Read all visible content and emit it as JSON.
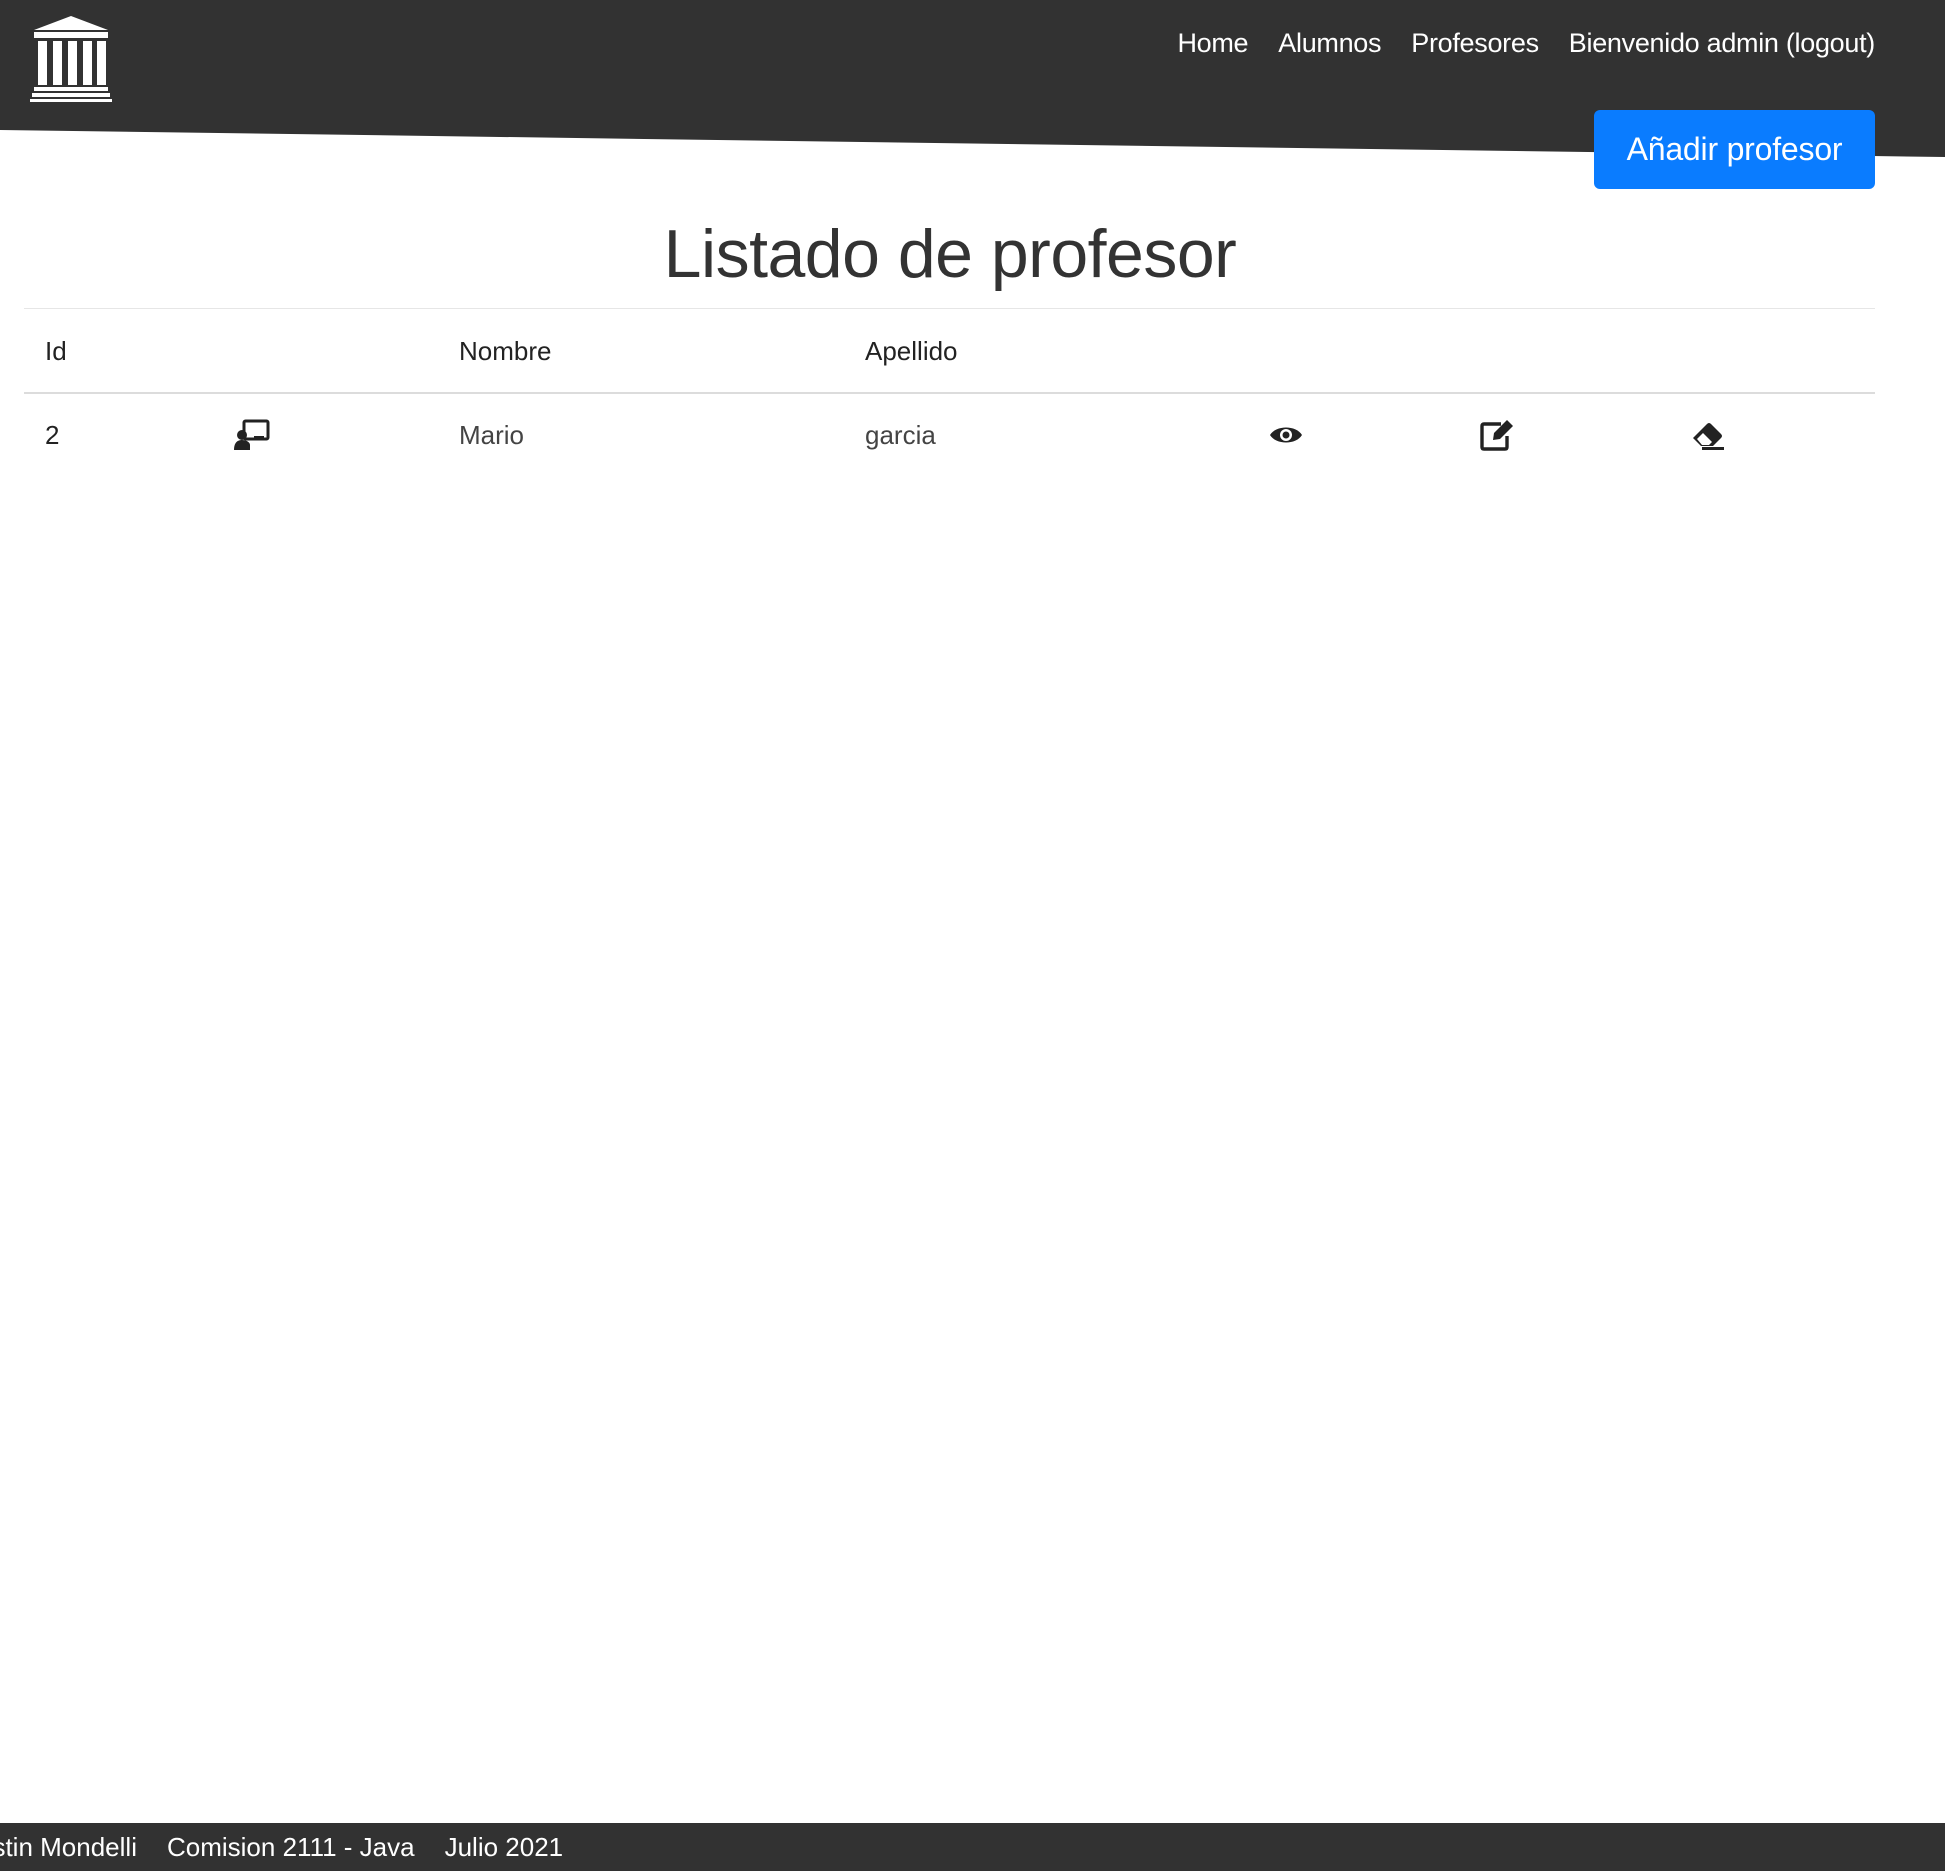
{
  "header": {
    "logo_icon": "building-columns-icon",
    "background_color": "#323232",
    "nav": [
      {
        "label": "Home"
      },
      {
        "label": "Alumnos"
      },
      {
        "label": "Profesores"
      },
      {
        "label": "Bienvenido admin (logout)"
      }
    ],
    "add_button_label": "Añadir profesor",
    "add_button_color": "#0a7cff"
  },
  "main": {
    "title": "Listado de profesor",
    "table": {
      "columns": [
        "Id",
        "",
        "Nombre",
        "Apellido",
        "",
        "",
        ""
      ],
      "rows": [
        {
          "id": "2",
          "avatar_icon": "chalkboard-teacher-icon",
          "nombre": "Mario",
          "apellido": "garcia",
          "actions": [
            "eye-icon",
            "edit-icon",
            "eraser-icon"
          ]
        }
      ]
    }
  },
  "footer": {
    "items": [
      "ustin Mondelli",
      "Comision 2111 - Java",
      "Julio 2021"
    ]
  }
}
